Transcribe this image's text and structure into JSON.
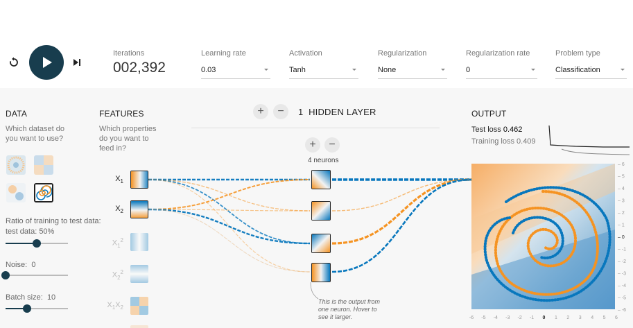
{
  "controls": {
    "iterations_label": "Iterations",
    "iterations_value": "002,392",
    "learning_rate": {
      "label": "Learning rate",
      "value": "0.03"
    },
    "activation": {
      "label": "Activation",
      "value": "Tanh"
    },
    "regularization": {
      "label": "Regularization",
      "value": "None"
    },
    "regularization_rate": {
      "label": "Regularization rate",
      "value": "0"
    },
    "problem_type": {
      "label": "Problem type",
      "value": "Classification"
    }
  },
  "data_panel": {
    "title": "DATA",
    "subtitle": "Which dataset do you want to use?",
    "selected_dataset": "spiral",
    "ratio_label": "Ratio of training to test data:",
    "ratio_value": "50%",
    "ratio_level": 0.5,
    "noise_label": "Noise:",
    "noise_value": "0",
    "noise_level": 0,
    "batch_label": "Batch size:",
    "batch_value": "10",
    "batch_level": 0.34
  },
  "features_panel": {
    "title": "FEATURES",
    "subtitle": "Which properties do you want to feed in?",
    "features": [
      {
        "base": "X",
        "sub": "1",
        "sup": ""
      },
      {
        "base": "X",
        "sub": "2",
        "sup": ""
      },
      {
        "base": "X",
        "sub": "1",
        "sup": "2"
      },
      {
        "base": "X",
        "sub": "2",
        "sup": "2"
      },
      {
        "base": "X",
        "sub": "1",
        "sup": "",
        "base2": "X",
        "sub2": "2"
      }
    ]
  },
  "network": {
    "layer_count": "1",
    "layer_title": "HIDDEN LAYER",
    "neurons_label": "4 neurons",
    "note": "This is the output from one neuron. Hover to see it larger."
  },
  "output_panel": {
    "title": "OUTPUT",
    "test_loss_label": "Test loss",
    "test_loss_value": "0.462",
    "training_loss_label": "Training loss",
    "training_loss_value": "0.409",
    "x_ticks": [
      "-6",
      "-5",
      "-4",
      "-3",
      "-2",
      "-1",
      "0",
      "1",
      "2",
      "3",
      "4",
      "5",
      "6"
    ],
    "y_ticks": [
      "6",
      "5",
      "4",
      "3",
      "2",
      "1",
      "0",
      "-1",
      "-2",
      "-3",
      "-4",
      "-5",
      "-6"
    ]
  },
  "colors": {
    "orange": "#f59322",
    "blue": "#0877bd",
    "dark": "#183d4e"
  }
}
